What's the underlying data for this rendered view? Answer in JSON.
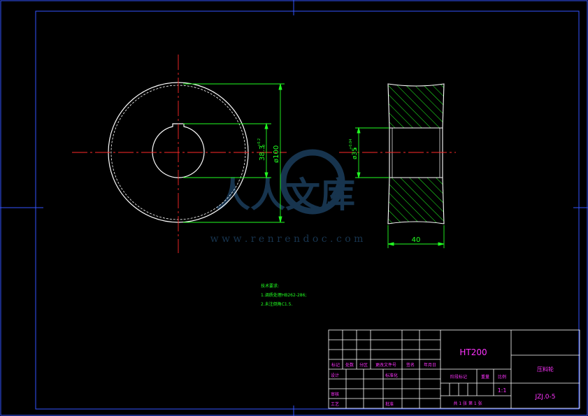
{
  "drawing": {
    "dimensions": {
      "keyway_depth": "38.3",
      "keyway_depth_tol_upper": "+0.2",
      "keyway_depth_tol_lower": "0",
      "outer_diameter": "ø100",
      "bore_diameter": "ø35",
      "bore_tol_upper": "+0.04",
      "bore_tol_lower": "0",
      "width": "40"
    },
    "notes": {
      "title": "技术要求:",
      "line1": "1.调质处理HB262-286;",
      "line2": "2.未注倒角C1.5."
    }
  },
  "watermark": {
    "text": "人人文库",
    "url": "w w w . r e n r e n d o c . c o m"
  },
  "title_block": {
    "material": "HT200",
    "part_name": "压料轮",
    "drawing_number": "JZJ.0-5",
    "scale": "1:1",
    "headers": [
      "标记",
      "处数",
      "分区",
      "更改文件号",
      "签名",
      "年月日"
    ],
    "design_label": "设计",
    "standardize_label": "标准化",
    "check_label": "审核",
    "process_label": "工艺",
    "approve_label": "批准",
    "stage_label": "阶段标记",
    "weight_label": "重量",
    "scale_label": "比例",
    "sheets_label": "共 1 张 第 1 张"
  },
  "colors": {
    "outline": "#ffffff",
    "center": "#ff2a2a",
    "dimension": "#22ff22",
    "frame": "#3355ff",
    "title_text": "#ff33ff",
    "table_line": "#ffffff"
  }
}
